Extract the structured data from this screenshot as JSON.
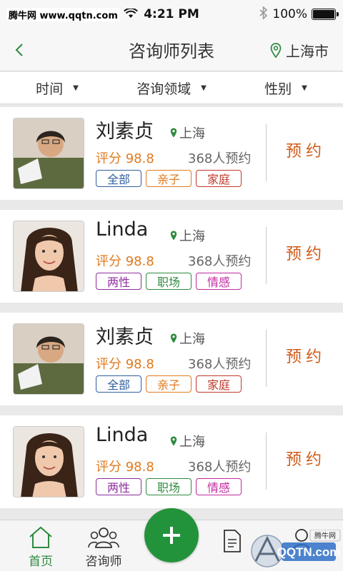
{
  "status_bar": {
    "watermark": "腾牛网 www.qqtn.com",
    "time": "4:21 PM",
    "battery": "100%",
    "battery_level": 1.0
  },
  "nav": {
    "title": "咨询师列表",
    "city": "上海市"
  },
  "filters": [
    {
      "label": "时间"
    },
    {
      "label": "咨询领域"
    },
    {
      "label": "性别"
    }
  ],
  "counselors": [
    {
      "name": "刘素贞",
      "location": "上海",
      "score": "评分 98.8",
      "bookings": "368人预约",
      "book_label": "预约",
      "tags": [
        {
          "label": "全部",
          "color": "#2f5f9e"
        },
        {
          "label": "亲子",
          "color": "#e07a1f"
        },
        {
          "label": "家庭",
          "color": "#c0392b"
        }
      ]
    },
    {
      "name": "Linda",
      "location": "上海",
      "score": "评分 98.8",
      "bookings": "368人预约",
      "book_label": "预约",
      "tags": [
        {
          "label": "两性",
          "color": "#8e2c9e"
        },
        {
          "label": "职场",
          "color": "#2e8b3e"
        },
        {
          "label": "情感",
          "color": "#c2289e"
        }
      ]
    },
    {
      "name": "刘素贞",
      "location": "上海",
      "score": "评分 98.8",
      "bookings": "368人预约",
      "book_label": "预约",
      "tags": [
        {
          "label": "全部",
          "color": "#2f5f9e"
        },
        {
          "label": "亲子",
          "color": "#e07a1f"
        },
        {
          "label": "家庭",
          "color": "#c0392b"
        }
      ]
    },
    {
      "name": "Linda",
      "location": "上海",
      "score": "评分 98.8",
      "bookings": "368人预约",
      "book_label": "预约",
      "tags": [
        {
          "label": "两性",
          "color": "#8e2c9e"
        },
        {
          "label": "职场",
          "color": "#2e8b3e"
        },
        {
          "label": "情感",
          "color": "#c2289e"
        }
      ]
    }
  ],
  "tab_bar": {
    "tabs": [
      {
        "label": "首页",
        "icon": "home-icon",
        "active": true
      },
      {
        "label": "咨询师",
        "icon": "group-icon",
        "active": false
      }
    ],
    "fab_icon": "plus-icon"
  },
  "colors": {
    "accent": "#23933b",
    "score": "#e07a1f",
    "book_button": "#d05a17"
  },
  "watermark_logo": "QQTN.com 腾牛网"
}
